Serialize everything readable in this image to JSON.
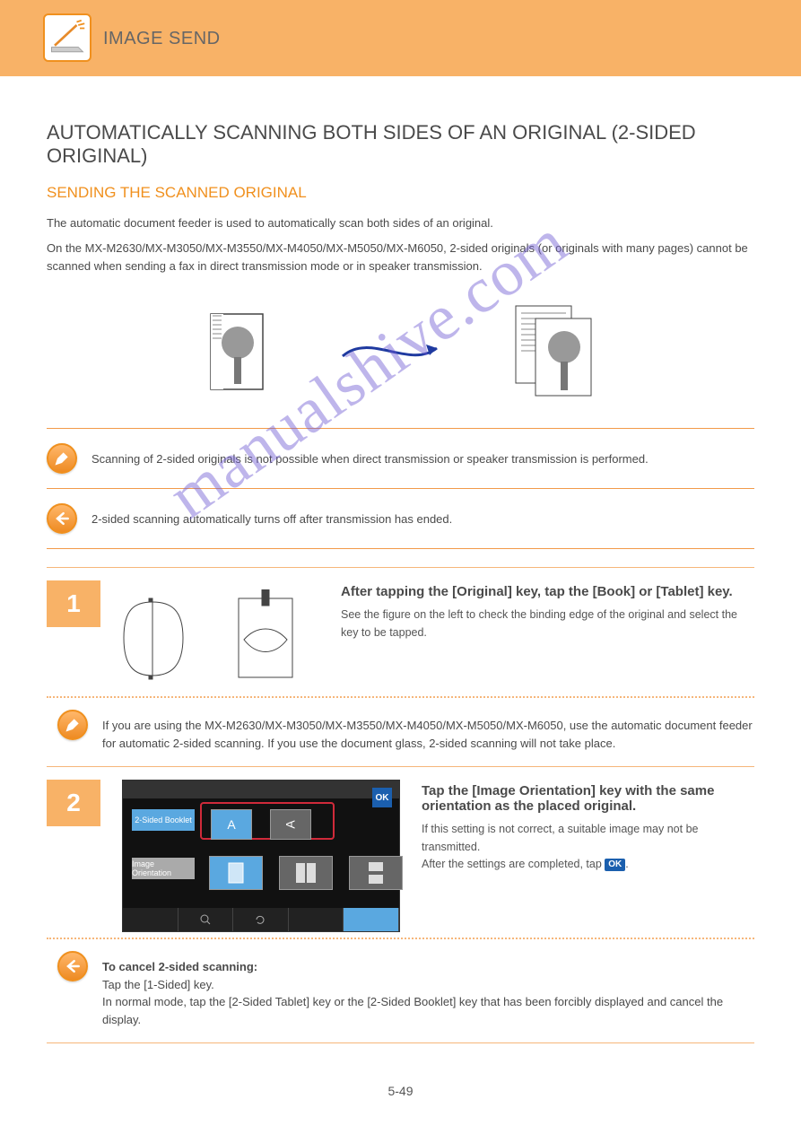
{
  "banner": {
    "title": "IMAGE SEND"
  },
  "header": {
    "h2": "AUTOMATICALLY SCANNING BOTH SIDES OF AN ORIGINAL (2-SIDED ORIGINAL)",
    "h3": "SENDING THE SCANNED ORIGINAL"
  },
  "intro": {
    "p1": "The automatic document feeder is used to automatically scan both sides of an original.",
    "p2": "On the MX-M2630/MX-M3050/MX-M3550/MX-M4050/MX-M5050/MX-M6050, 2-sided originals (or originals with many pages) cannot be scanned when sending a fax in direct transmission mode or in speaker transmission."
  },
  "note": {
    "pencil": "Scanning of 2-sided originals is not possible when direct transmission or speaker transmission is performed.",
    "back": "2-sided scanning automatically turns off after transmission has ended."
  },
  "step1": {
    "num": "1",
    "title": "After tapping the [Original] key, tap the [Book] or [Tablet] key.",
    "detail": "See the figure on the left to check the binding edge of the original and select the key to be tapped.",
    "pencil": "If you are using the MX-M2630/MX-M3050/MX-M3550/MX-M4050/MX-M5050/MX-M6050, use the automatic document feeder for automatic 2-sided scanning. If you use the document glass, 2-sided scanning will not take place."
  },
  "step2": {
    "num": "2",
    "title": "Tap the [Image Orientation] key with the same orientation as the placed original.",
    "detail_before": "If this setting is not correct, a suitable image may not be transmitted.\nAfter the settings are completed, tap ",
    "ok": "OK",
    "detail_after": ".",
    "back_before": "To cancel 2-sided scanning:",
    "back_line2": "Tap the [1-Sided] key.",
    "back_line3": "In normal mode, tap the [2-Sided Tablet] key or the [2-Sided Booklet] key that has been forcibly displayed and cancel the display."
  },
  "panel": {
    "ok": "OK",
    "tab1": "2-Sided Booklet",
    "tab2": "Image Orientation",
    "A": "A",
    "sideA": "A"
  },
  "icons": {
    "scanner": "scanner-icon",
    "pencil": "pencil-icon",
    "back": "back-arrow-icon",
    "book_open": "book-open-icon",
    "tablet": "tablet-icon"
  },
  "page_number": "5-49",
  "watermark": "manualshive.com"
}
